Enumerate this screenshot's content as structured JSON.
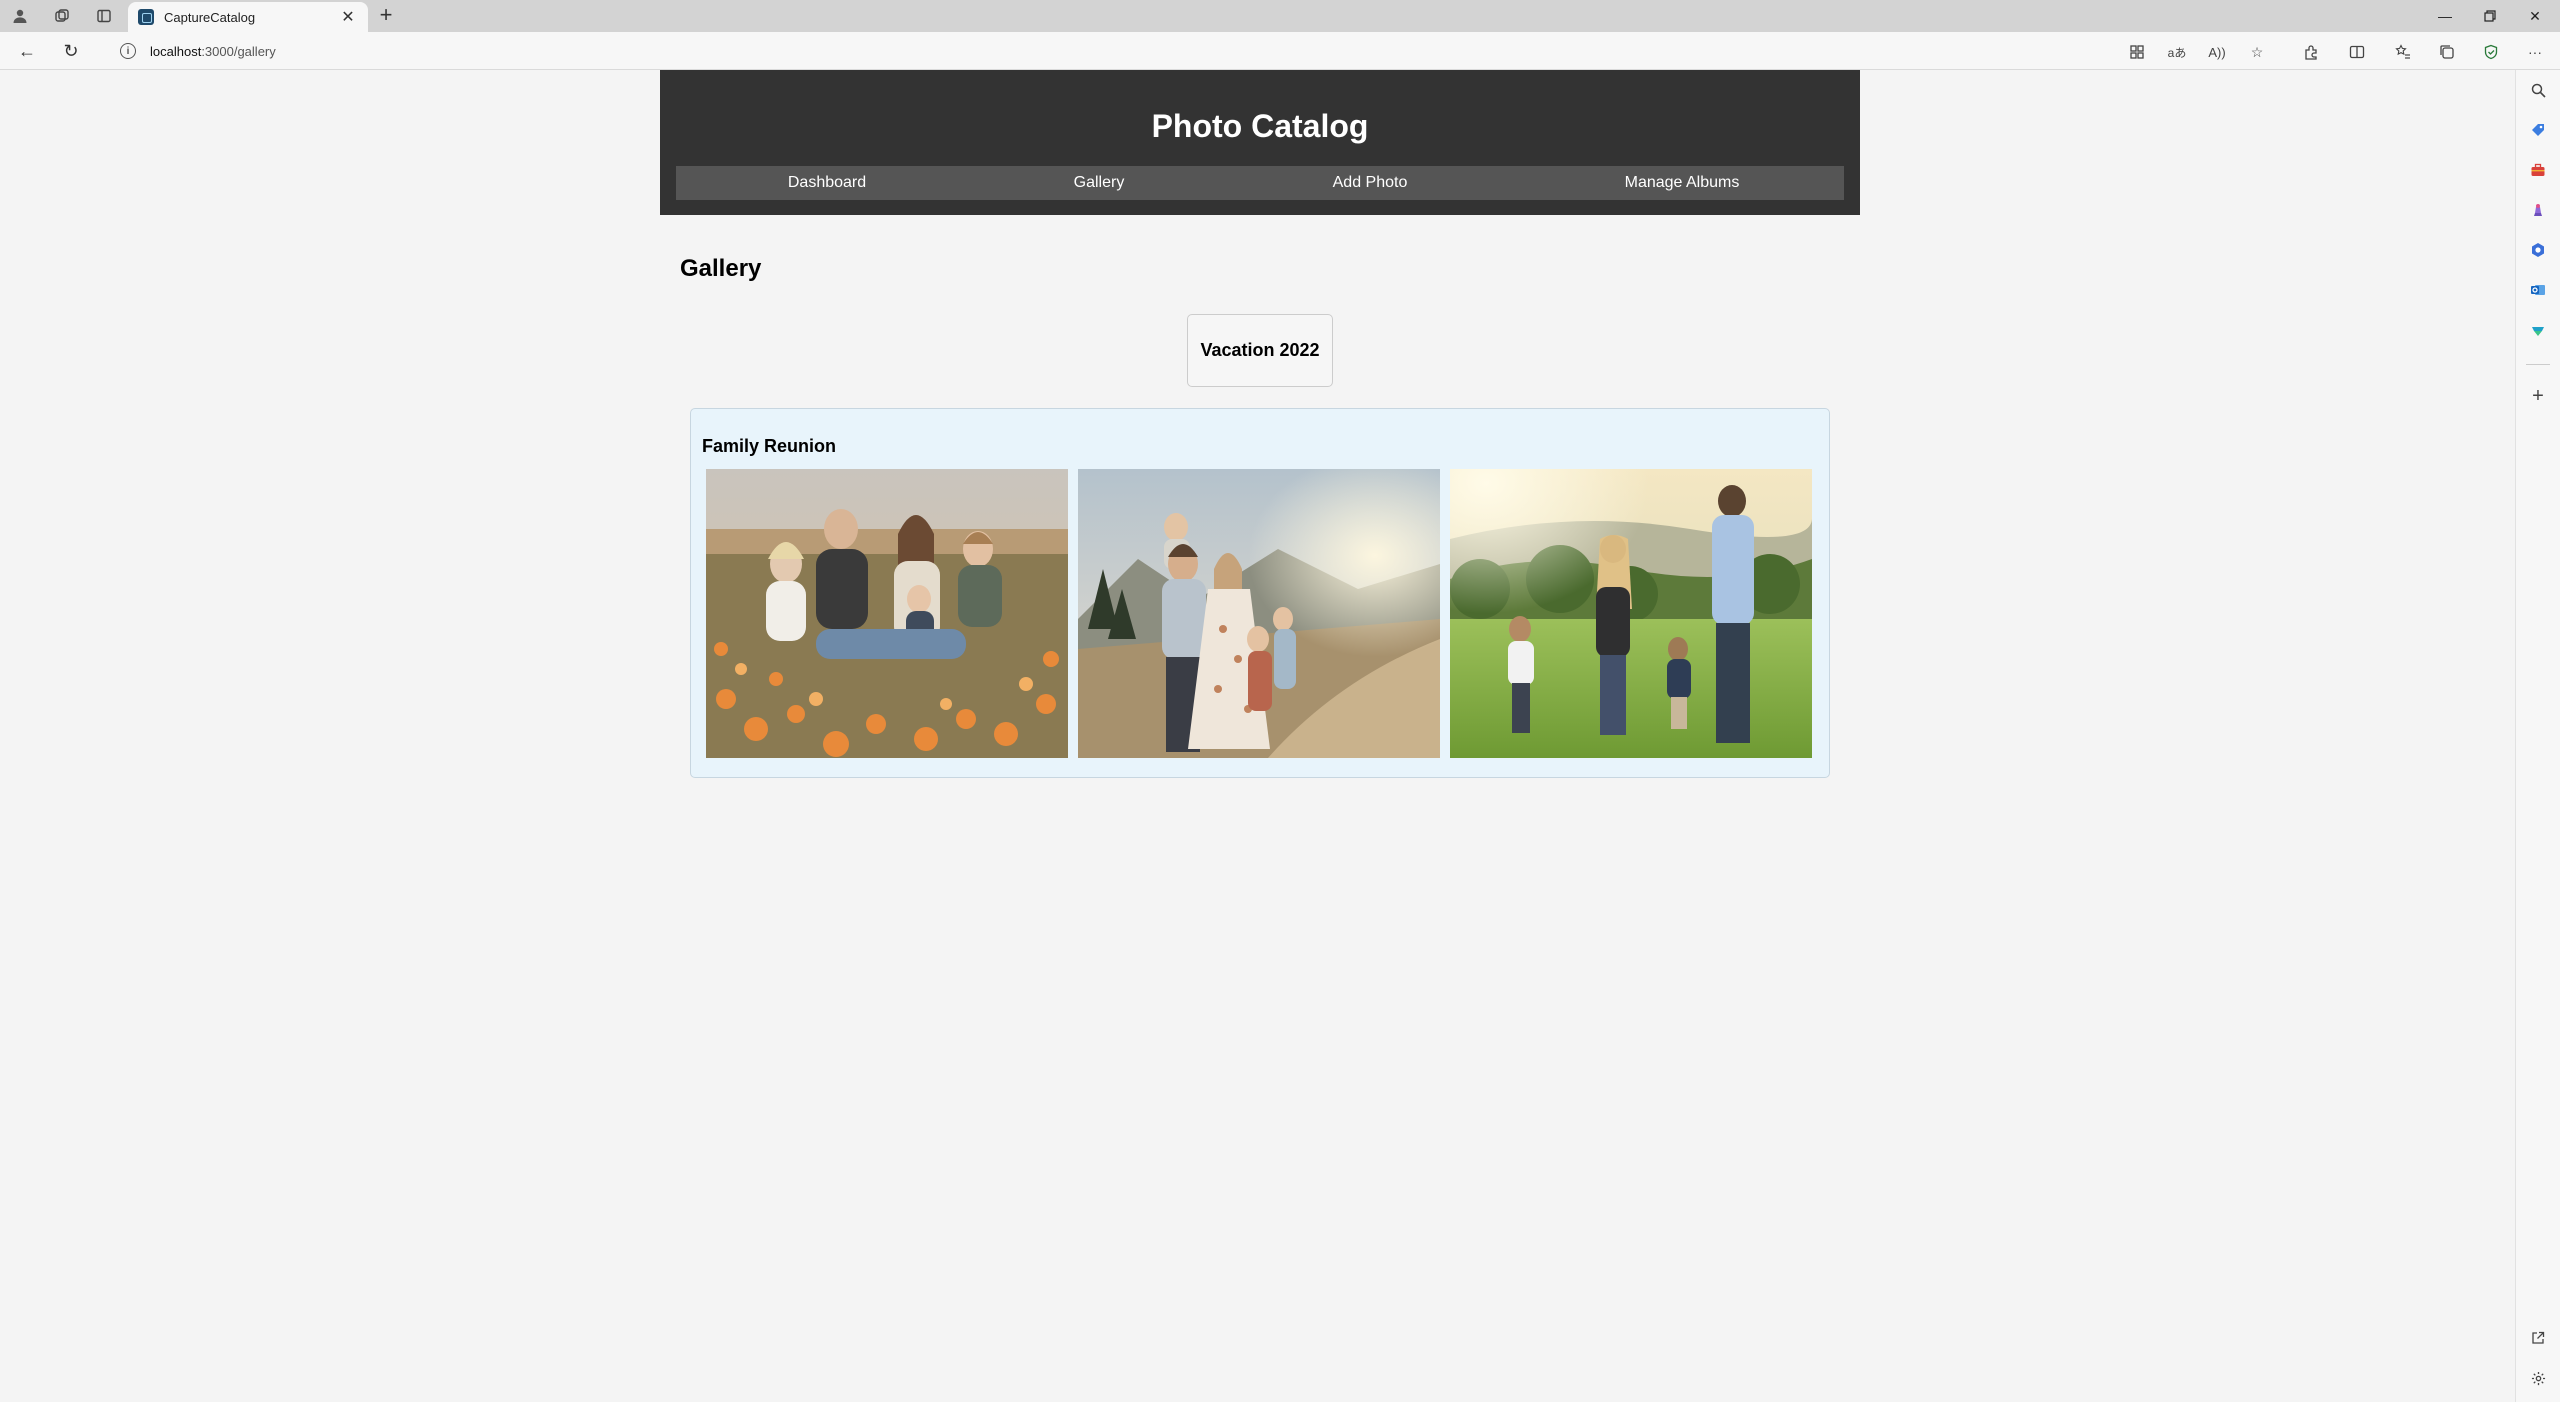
{
  "browser": {
    "tab_title": "CaptureCatalog",
    "url_host": "localhost",
    "url_path": ":3000/gallery"
  },
  "site": {
    "title": "Photo Catalog",
    "nav": [
      "Dashboard",
      "Gallery",
      "Add Photo",
      "Manage Albums"
    ]
  },
  "page": {
    "heading": "Gallery"
  },
  "albums": [
    {
      "name": "Vacation 2022",
      "photo_count": 0
    },
    {
      "name": "Family Reunion",
      "photos": [
        {
          "description": "family of five sitting in a field of orange poppies"
        },
        {
          "description": "family standing on a dirt mountain road at sunset"
        },
        {
          "description": "family walking away through a sunny green meadow"
        }
      ]
    }
  ],
  "colors": {
    "header_bg": "#333333",
    "nav_bg": "#555555",
    "page_bg": "#f4f4f4",
    "album_panel_bg": "#e8f4fb"
  }
}
